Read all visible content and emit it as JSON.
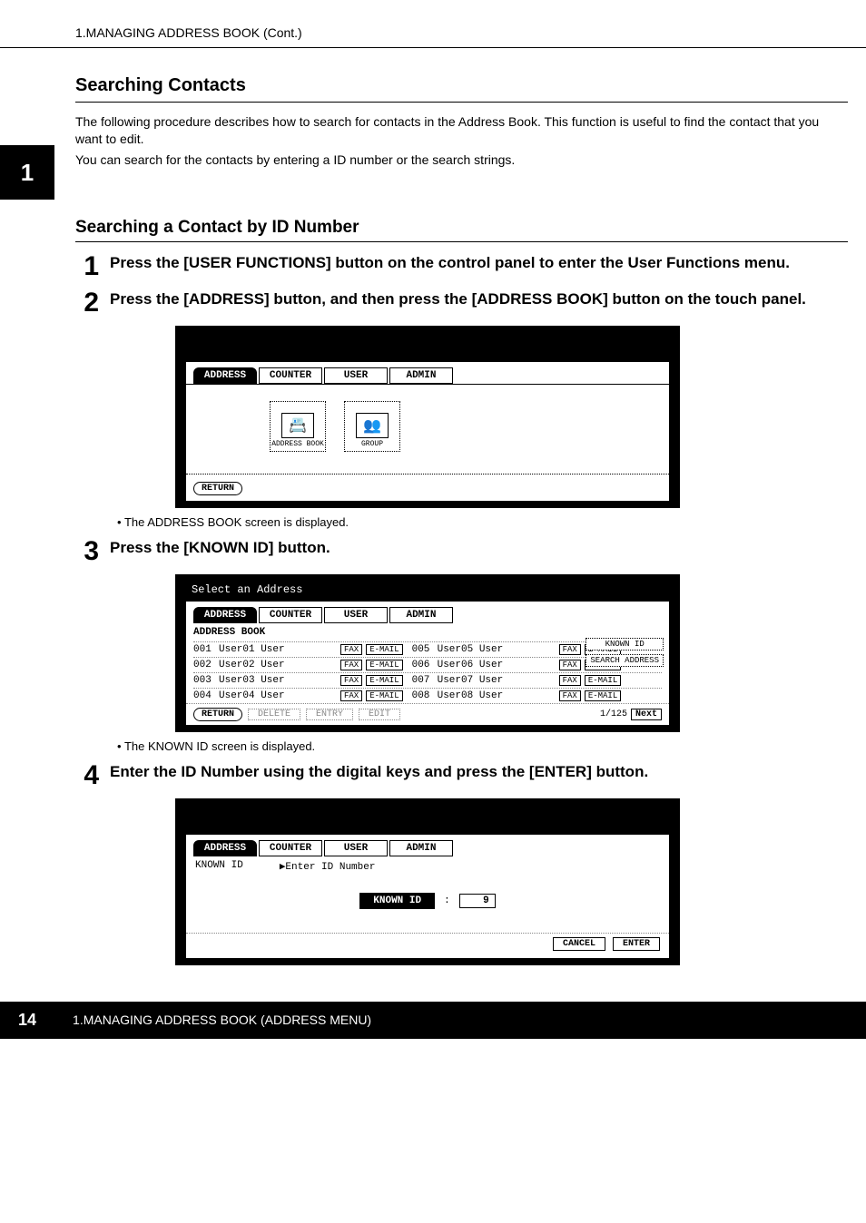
{
  "header": {
    "breadcrumb": "1.MANAGING ADDRESS BOOK (Cont.)"
  },
  "chapter_tab": "1",
  "section": {
    "title": "Searching Contacts",
    "para1": "The following procedure describes how to search for contacts in the Address Book.  This function is useful to find the contact that you want to edit.",
    "para2": "You can search for the contacts by entering a ID number or the search strings."
  },
  "subsection": {
    "title": "Searching a Contact by ID Number"
  },
  "steps": {
    "s1": {
      "num": "1",
      "text": "Press the [USER FUNCTIONS] button on the control panel to enter the User Functions menu."
    },
    "s2": {
      "num": "2",
      "text": "Press the [ADDRESS] button, and then press the [ADDRESS BOOK] button on the touch panel."
    },
    "s2_note": "The ADDRESS BOOK screen is displayed.",
    "s3": {
      "num": "3",
      "text": "Press the [KNOWN ID] button."
    },
    "s3_note": "The KNOWN ID screen is displayed.",
    "s4": {
      "num": "4",
      "text": "Enter the ID Number using the digital keys and press the [ENTER] button."
    }
  },
  "ui": {
    "tabs": {
      "address": "ADDRESS",
      "counter": "COUNTER",
      "user": "USER",
      "admin": "ADMIN"
    },
    "icons": {
      "address_book": "ADDRESS BOOK",
      "group": "GROUP"
    },
    "return": "RETURN",
    "select_prompt": "Select an Address",
    "list_title": "ADDRESS BOOK",
    "fax": "FAX",
    "email": "E-MAIL",
    "known_id": "KNOWN ID",
    "search_address": "SEARCH ADDRESS",
    "delete": "DELETE",
    "entry": "ENTRY",
    "edit": "EDIT",
    "page": "1/125",
    "next": "Next",
    "enter_id": "▶Enter ID Number",
    "colon": ":",
    "known_id_value": "9",
    "cancel": "CANCEL",
    "enter": "ENTER",
    "rows": [
      {
        "id": "001",
        "name": "User01 User",
        "id2": "005",
        "name2": "User05 User"
      },
      {
        "id": "002",
        "name": "User02 User",
        "id2": "006",
        "name2": "User06 User"
      },
      {
        "id": "003",
        "name": "User03 User",
        "id2": "007",
        "name2": "User07 User"
      },
      {
        "id": "004",
        "name": "User04 User",
        "id2": "008",
        "name2": "User08 User"
      }
    ]
  },
  "footer": {
    "page": "14",
    "text": "1.MANAGING ADDRESS BOOK (ADDRESS MENU)"
  }
}
